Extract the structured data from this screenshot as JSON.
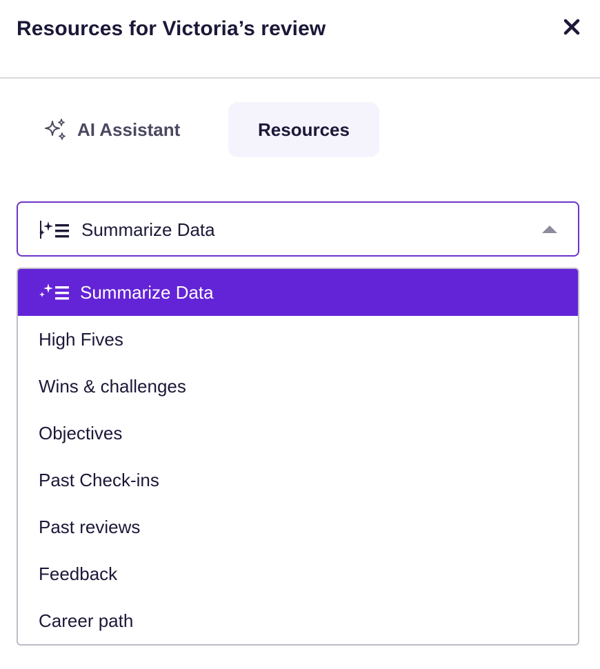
{
  "header": {
    "title": "Resources for Victoria’s review",
    "close_icon": "close-icon"
  },
  "tabs": [
    {
      "label": "AI Assistant",
      "icon": "sparkles-icon",
      "active": false
    },
    {
      "label": "Resources",
      "active": true
    }
  ],
  "select": {
    "value": "Summarize Data",
    "icon": "sparkle-list-icon",
    "expanded": true
  },
  "options": [
    {
      "label": "Summarize Data",
      "icon": "sparkle-list-icon",
      "selected": true
    },
    {
      "label": "High Fives"
    },
    {
      "label": "Wins & challenges"
    },
    {
      "label": "Objectives"
    },
    {
      "label": "Past Check-ins"
    },
    {
      "label": "Past reviews"
    },
    {
      "label": "Feedback"
    },
    {
      "label": "Career path"
    }
  ],
  "colors": {
    "accent": "#6323d6",
    "select_border": "#6b33c8",
    "tab_active_bg": "#f5f3fc",
    "text": "#1b1838"
  }
}
